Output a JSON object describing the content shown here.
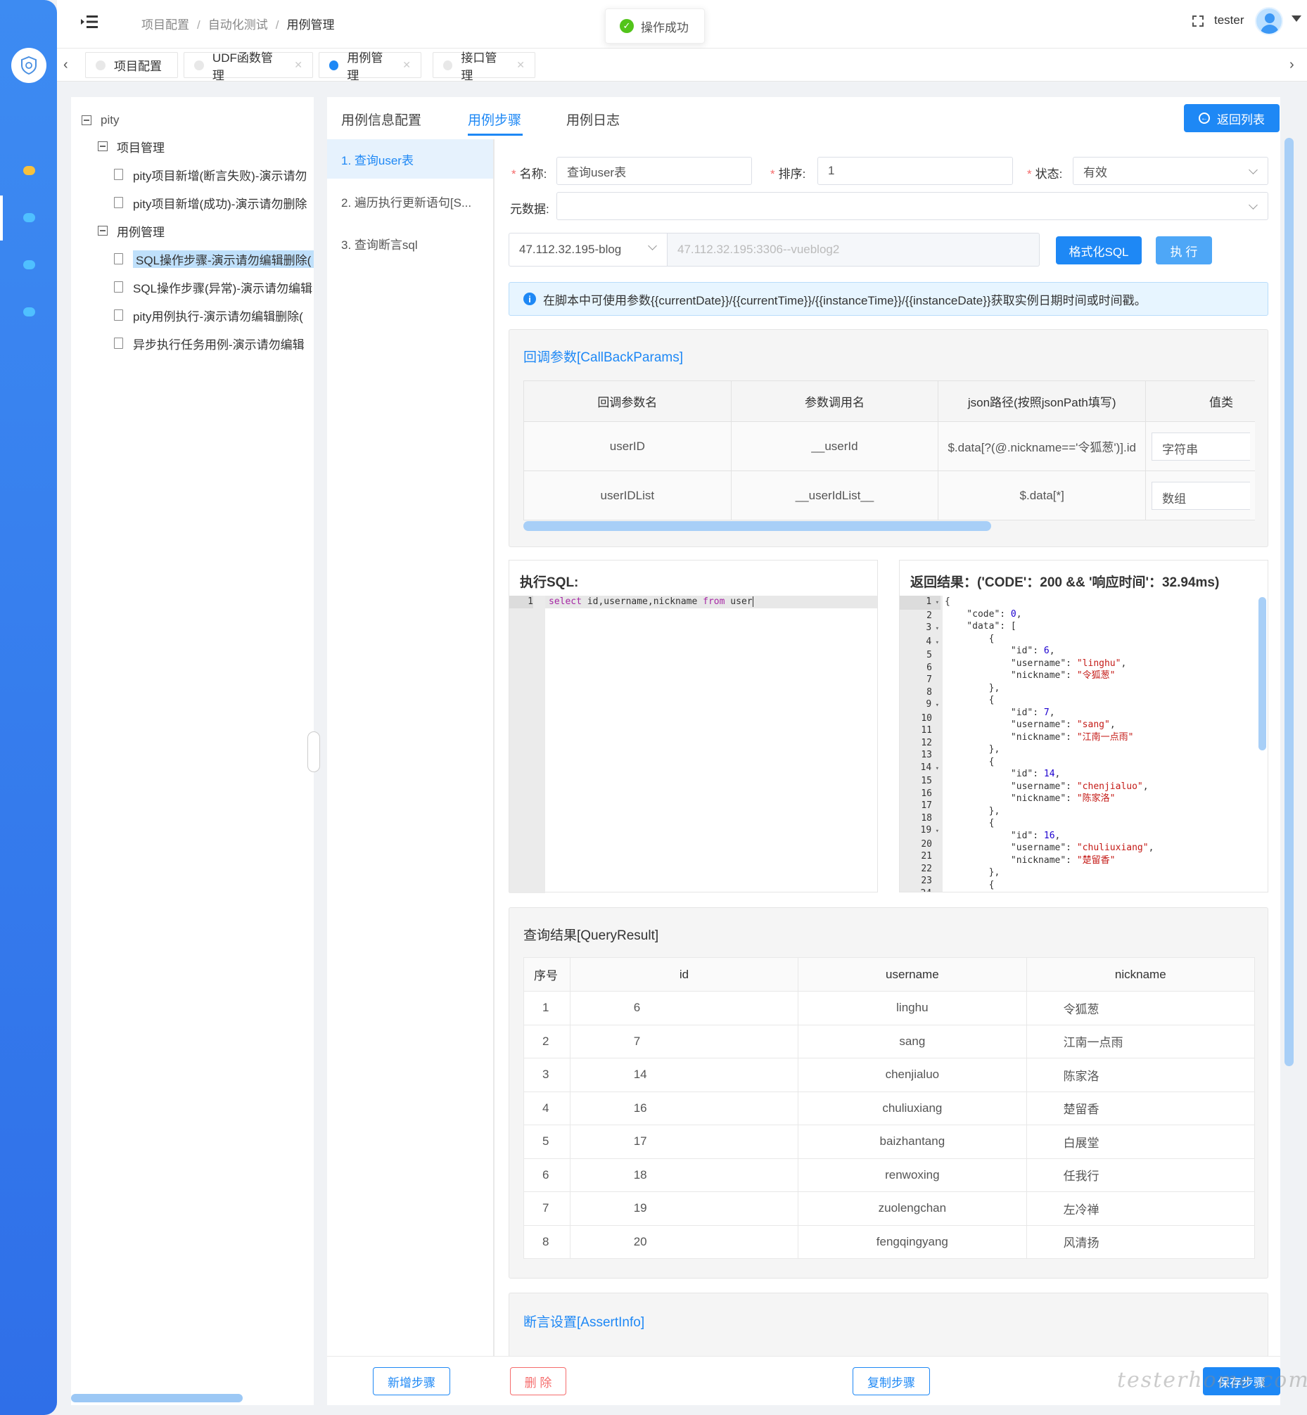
{
  "header": {
    "breadcrumb": [
      "项目配置",
      "自动化测试",
      "用例管理"
    ],
    "toast": "操作成功",
    "username": "tester"
  },
  "tabs": [
    {
      "label": "项目配置",
      "active": false,
      "closable": false
    },
    {
      "label": "UDF函数管理",
      "active": false,
      "closable": true
    },
    {
      "label": "用例管理",
      "active": true,
      "closable": true
    },
    {
      "label": "接口管理",
      "active": false,
      "closable": true
    }
  ],
  "tree": {
    "root": "pity",
    "groups": [
      {
        "label": "项目管理",
        "items": [
          "pity项目新增(断言失败)-演示请勿",
          "pity项目新增(成功)-演示请勿删除"
        ]
      },
      {
        "label": "用例管理",
        "items": [
          "SQL操作步骤-演示请勿编辑删除(",
          "SQL操作步骤(异常)-演示请勿编辑",
          "pity用例执行-演示请勿编辑删除(",
          "异步执行任务用例-演示请勿编辑"
        ]
      }
    ],
    "selected": "SQL操作步骤-演示请勿编辑删除("
  },
  "main_tabs": [
    "用例信息配置",
    "用例步骤",
    "用例日志"
  ],
  "active_main_tab": "用例步骤",
  "back_button": "返回列表",
  "steps": [
    "1. 查询user表",
    "2. 遍历执行更新语句[S...",
    "3. 查询断言sql"
  ],
  "form": {
    "name_label": "名称:",
    "name_value": "查询user表",
    "order_label": "排序:",
    "order_value": "1",
    "status_label": "状态:",
    "status_value": "有效",
    "meta_label": "元数据:",
    "meta_value": "",
    "db_select": "47.112.32.195-blog",
    "db_addr_placeholder": "47.112.32.195:3306--vueblog2",
    "format_sql_button": "格式化SQL",
    "execute_button": "执 行"
  },
  "alert": "在脚本中可使用参数{{currentDate}}/{{currentTime}}/{{instanceTime}}/{{instanceDate}}获取实例日期时间或时间戳。",
  "callback": {
    "title": "回调参数[CallBackParams]",
    "columns": [
      "回调参数名",
      "参数调用名",
      "json路径(按照jsonPath填写)",
      "值类"
    ],
    "rows": [
      {
        "name": "userID",
        "call": "__userId",
        "path": "$.data[?(@.nickname=='令狐葱')].id",
        "type": "字符串"
      },
      {
        "name": "userIDList",
        "call": "__userIdList__",
        "path": "$.data[*]",
        "type": "数组"
      }
    ]
  },
  "sql_editor": {
    "title": "执行SQL:",
    "line": "1",
    "tokens": {
      "select": "select",
      "cols": " id,username,nickname ",
      "from": "from",
      "table": " user"
    }
  },
  "result_editor": {
    "title": "返回结果：('CODE'：200 && '响应时间'：32.94ms)",
    "lines": [
      {
        "n": "1",
        "fold": true,
        "t": "{"
      },
      {
        "n": "2",
        "fold": false,
        "t": "    \"code\": 0,"
      },
      {
        "n": "3",
        "fold": true,
        "t": "    \"data\": ["
      },
      {
        "n": "4",
        "fold": true,
        "t": "        {"
      },
      {
        "n": "5",
        "fold": false,
        "t": "            \"id\": 6,"
      },
      {
        "n": "6",
        "fold": false,
        "t": "            \"username\": \"linghu\","
      },
      {
        "n": "7",
        "fold": false,
        "t": "            \"nickname\": \"令狐葱\""
      },
      {
        "n": "8",
        "fold": false,
        "t": "        },"
      },
      {
        "n": "9",
        "fold": true,
        "t": "        {"
      },
      {
        "n": "10",
        "fold": false,
        "t": "            \"id\": 7,"
      },
      {
        "n": "11",
        "fold": false,
        "t": "            \"username\": \"sang\","
      },
      {
        "n": "12",
        "fold": false,
        "t": "            \"nickname\": \"江南一点雨\""
      },
      {
        "n": "13",
        "fold": false,
        "t": "        },"
      },
      {
        "n": "14",
        "fold": true,
        "t": "        {"
      },
      {
        "n": "15",
        "fold": false,
        "t": "            \"id\": 14,"
      },
      {
        "n": "16",
        "fold": false,
        "t": "            \"username\": \"chenjialuo\","
      },
      {
        "n": "17",
        "fold": false,
        "t": "            \"nickname\": \"陈家洛\""
      },
      {
        "n": "18",
        "fold": false,
        "t": "        },"
      },
      {
        "n": "19",
        "fold": true,
        "t": "        {"
      },
      {
        "n": "20",
        "fold": false,
        "t": "            \"id\": 16,"
      },
      {
        "n": "21",
        "fold": false,
        "t": "            \"username\": \"chuliuxiang\","
      },
      {
        "n": "22",
        "fold": false,
        "t": "            \"nickname\": \"楚留香\""
      },
      {
        "n": "23",
        "fold": false,
        "t": "        },"
      },
      {
        "n": "24",
        "fold": true,
        "t": "        {"
      }
    ]
  },
  "query_result": {
    "title": "查询结果[QueryResult]",
    "columns": [
      "序号",
      "id",
      "username",
      "nickname"
    ],
    "rows": [
      [
        "1",
        "6",
        "linghu",
        "令狐葱"
      ],
      [
        "2",
        "7",
        "sang",
        "江南一点雨"
      ],
      [
        "3",
        "14",
        "chenjialuo",
        "陈家洛"
      ],
      [
        "4",
        "16",
        "chuliuxiang",
        "楚留香"
      ],
      [
        "5",
        "17",
        "baizhantang",
        "白展堂"
      ],
      [
        "6",
        "18",
        "renwoxing",
        "任我行"
      ],
      [
        "7",
        "19",
        "zuolengchan",
        "左冷禅"
      ],
      [
        "8",
        "20",
        "fengqingyang",
        "风清扬"
      ]
    ]
  },
  "assert_title": "断言设置[AssertInfo]",
  "footer": {
    "add_step": "新增步骤",
    "delete": "删 除",
    "copy_step": "复制步骤",
    "save_step": "保存步骤"
  },
  "watermark": "testerhome.com",
  "colors": {
    "primary": "#1e88f5",
    "success": "#52c41a",
    "danger": "#f56c6c",
    "sidebar": "#3d8bf2"
  }
}
